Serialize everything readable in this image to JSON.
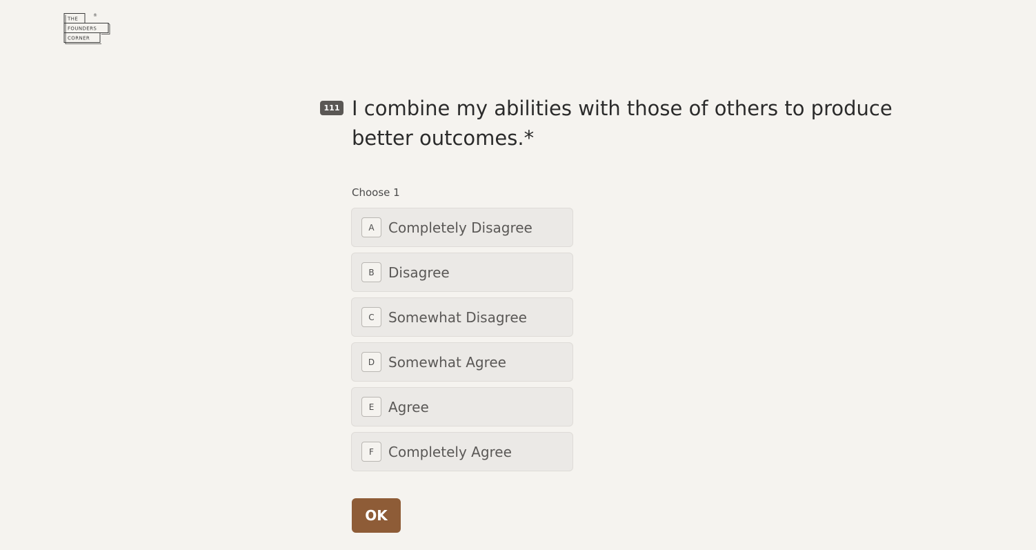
{
  "logo": {
    "lines": [
      "THE",
      "FOUNDERS",
      "CORNER"
    ],
    "mark": "®"
  },
  "question": {
    "number": "111",
    "text": "I combine my abilities with those of others to produce better outcomes.*"
  },
  "choose_label": "Choose 1",
  "options": [
    {
      "key": "A",
      "label": "Completely Disagree"
    },
    {
      "key": "B",
      "label": "Disagree"
    },
    {
      "key": "C",
      "label": "Somewhat Disagree"
    },
    {
      "key": "D",
      "label": "Somewhat Agree"
    },
    {
      "key": "E",
      "label": "Agree"
    },
    {
      "key": "F",
      "label": "Completely Agree"
    }
  ],
  "ok_button": {
    "label": "OK"
  },
  "colors": {
    "background": "#f5f3ef",
    "accent": "#8e5c37",
    "option_bg": "#ebe9e6",
    "badge_bg": "#5a5754"
  }
}
